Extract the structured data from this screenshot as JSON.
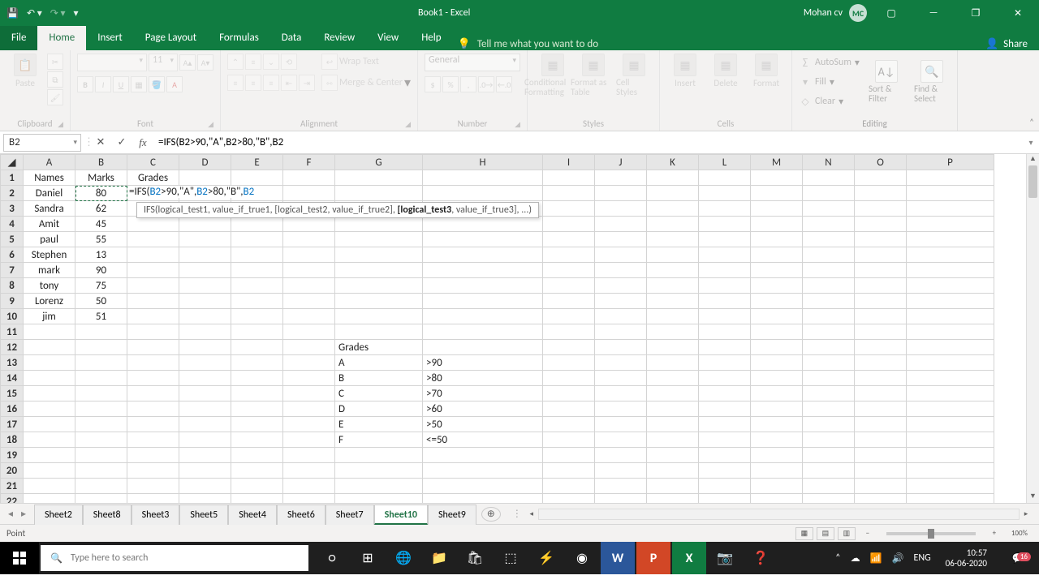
{
  "titlebar": {
    "title": "Book1  -  Excel",
    "user": "Mohan cv",
    "avatar": "MC"
  },
  "tabs": {
    "file": "File",
    "home": "Home",
    "insert": "Insert",
    "pagelayout": "Page Layout",
    "formulas": "Formulas",
    "data": "Data",
    "review": "Review",
    "view": "View",
    "help": "Help",
    "tellme": "Tell me what you want to do",
    "share": "Share"
  },
  "ribbon": {
    "clipboard": {
      "paste": "Paste",
      "label": "Clipboard"
    },
    "font": {
      "size": "11",
      "label": "Font"
    },
    "alignment": {
      "wrap": "Wrap Text",
      "merge": "Merge & Center",
      "label": "Alignment"
    },
    "number": {
      "format": "General",
      "label": "Number"
    },
    "styles": {
      "cf": "Conditional Formatting",
      "fat": "Format as Table",
      "cs": "Cell Styles",
      "label": "Styles"
    },
    "cells": {
      "insert": "Insert",
      "delete": "Delete",
      "format": "Format",
      "label": "Cells"
    },
    "editing": {
      "autosum": "AutoSum",
      "fill": "Fill",
      "clear": "Clear",
      "sort": "Sort & Filter",
      "find": "Find & Select",
      "label": "Editing"
    }
  },
  "fxbar": {
    "namebox": "B2",
    "formula": "=IFS(B2>90,\"A\",B2>80,\"B\",B2"
  },
  "tooltip": {
    "pre": "IFS(logical_test1, value_if_true1, [logical_test2, value_if_true2], ",
    "bold": "[logical_test3",
    "post": ", value_if_true3], ...)"
  },
  "headers": [
    "A",
    "B",
    "C",
    "D",
    "E",
    "F",
    "G",
    "H",
    "I",
    "J",
    "K",
    "L",
    "M",
    "N",
    "O",
    "P"
  ],
  "chart_data": {
    "type": "table",
    "main": {
      "columns": [
        "Names",
        "Marks",
        "Grades"
      ],
      "rows": [
        {
          "name": "Daniel",
          "marks": 80
        },
        {
          "name": "Sandra",
          "marks": 62
        },
        {
          "name": "Amit",
          "marks": 45
        },
        {
          "name": "paul",
          "marks": 55
        },
        {
          "name": "Stephen",
          "marks": 13
        },
        {
          "name": "mark",
          "marks": 90
        },
        {
          "name": "tony",
          "marks": 75
        },
        {
          "name": "Lorenz",
          "marks": 50
        },
        {
          "name": "jim",
          "marks": 51
        }
      ]
    },
    "lookup": {
      "title": "Grades",
      "rows": [
        {
          "grade": "A",
          "cond": ">90"
        },
        {
          "grade": "B",
          "cond": ">80"
        },
        {
          "grade": "C",
          "cond": ">70"
        },
        {
          "grade": "D",
          "cond": ">60"
        },
        {
          "grade": "E",
          "cond": ">50"
        },
        {
          "grade": "F",
          "cond": "<=50"
        }
      ]
    }
  },
  "editing_cell_display": "=IFS(B2>90,\"A\",B2>80,\"B\",B2",
  "b2_display": "80",
  "sheets": [
    "Sheet2",
    "Sheet8",
    "Sheet3",
    "Sheet5",
    "Sheet4",
    "Sheet6",
    "Sheet7",
    "Sheet10",
    "Sheet9"
  ],
  "active_sheet": "Sheet10",
  "status": {
    "mode": "Point",
    "zoom": "100%"
  },
  "taskbar": {
    "search_placeholder": "Type here to search",
    "lang": "ENG",
    "time": "10:57",
    "date": "06-06-2020",
    "notif_count": "16"
  }
}
